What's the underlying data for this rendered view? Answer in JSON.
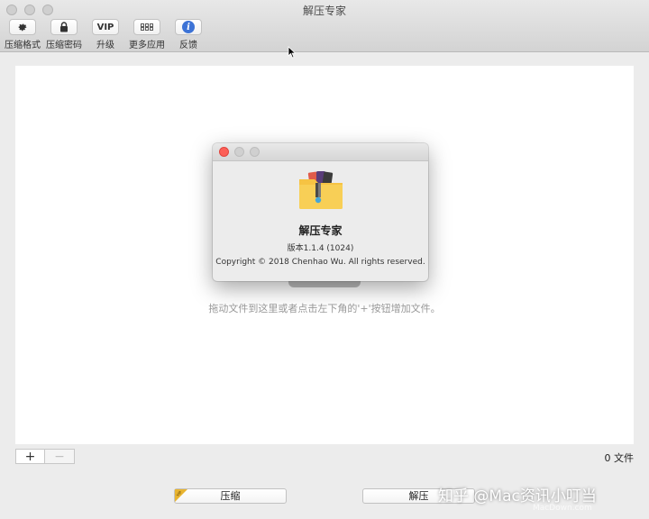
{
  "window": {
    "title": "解压专家"
  },
  "toolbar": {
    "items": [
      {
        "label": "压缩格式",
        "icon": "gear-icon"
      },
      {
        "label": "压缩密码",
        "icon": "lock-icon"
      },
      {
        "label": "升级",
        "icon_text": "VIP"
      },
      {
        "label": "更多应用",
        "icon": "grid-icon"
      },
      {
        "label": "反馈",
        "icon": "info-icon",
        "icon_text": "i"
      }
    ]
  },
  "main": {
    "drop_hint": "拖动文件到这里或者点击左下角的'+'按钮增加文件。",
    "file_count": "0 文件",
    "add_label": "+",
    "remove_label": "−"
  },
  "about": {
    "app_name": "解压专家",
    "version": "版本1.1.4 (1024)",
    "copyright": "Copyright © 2018 Chenhao Wu. All rights reserved."
  },
  "actions": {
    "compress_label": "压缩",
    "extract_label": "解压"
  },
  "watermark": {
    "text": "知乎 @Mac资讯小叮当",
    "sub": "MacDown.com"
  },
  "colors": {
    "close_red": "#fc5f57",
    "info_blue": "#3d73d6",
    "folder_yellow": "#f6c343"
  }
}
